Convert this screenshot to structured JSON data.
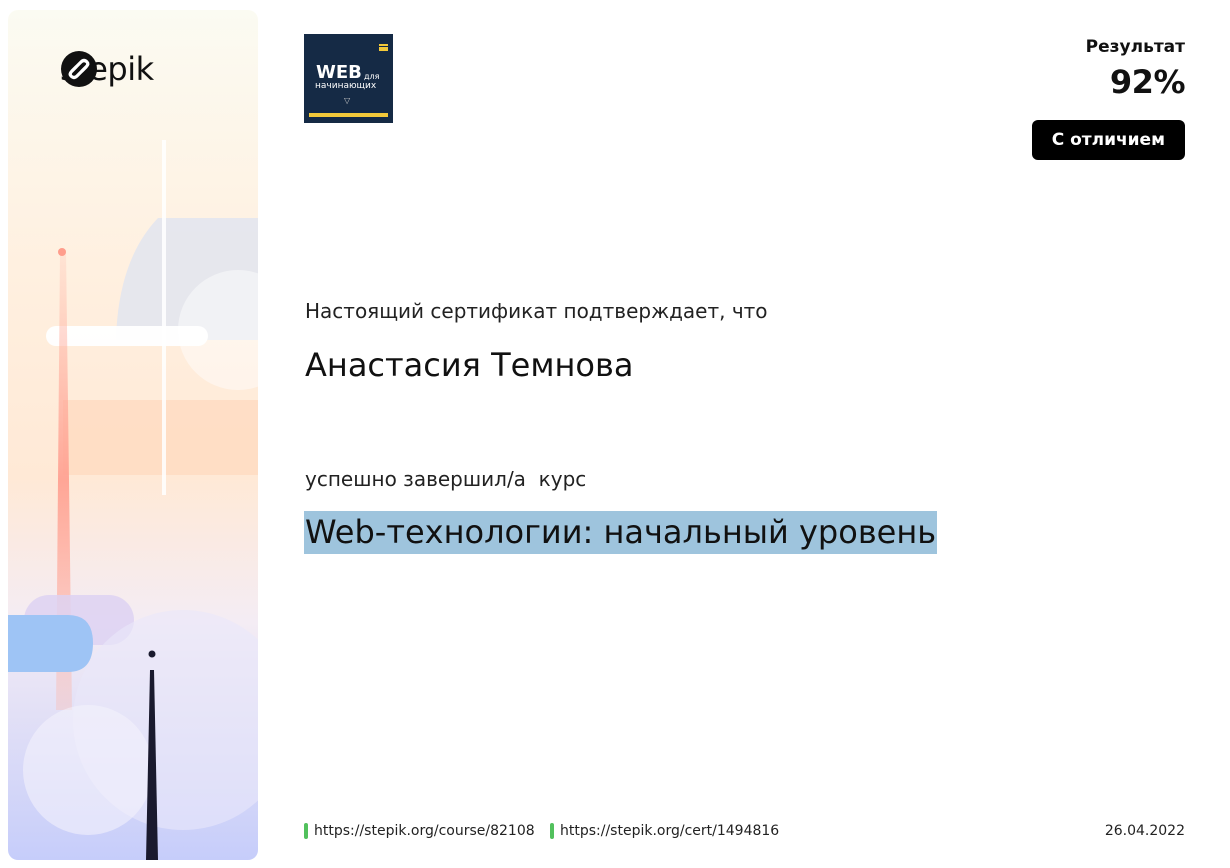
{
  "brand": {
    "name": "stepik",
    "logo_icon": "stepik-logo-icon"
  },
  "course_badge": {
    "line1": "WEB",
    "line2": "для",
    "line3": "начинающих"
  },
  "result": {
    "label": "Результат",
    "value": "92%",
    "distinction": "С отличием"
  },
  "certificate": {
    "intro": "Настоящий сертификат подтверждает, что",
    "recipient": "Анастасия Темнова",
    "completed": "успешно завершил/а  курс",
    "course_title": "Web-технологии: начальный уровень"
  },
  "footer": {
    "course_url": "https://stepik.org/course/82108",
    "cert_url": "https://stepik.org/cert/1494816",
    "date": "26.04.2022"
  },
  "colors": {
    "highlight": "#9ec4dd",
    "link_marker": "#52c15d",
    "button_bg": "#000000",
    "badge_bg": "#152a45",
    "badge_accent": "#f3c93a"
  }
}
